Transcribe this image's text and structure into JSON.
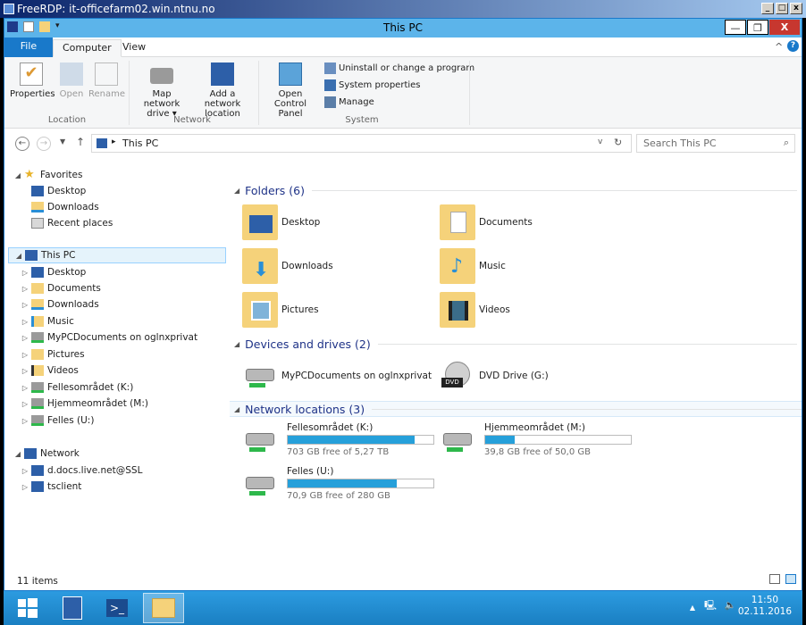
{
  "rdp": {
    "title": "FreeRDP: it-officefarm02.win.ntnu.no",
    "min": "_",
    "max": "□",
    "close": "x"
  },
  "window": {
    "title": "This PC",
    "min": "—",
    "max": "❐",
    "close": "X"
  },
  "ribbon": {
    "tabs": [
      "File",
      "Computer",
      "View"
    ],
    "location": {
      "group": "Location",
      "properties": "Properties",
      "open": "Open",
      "rename": "Rename"
    },
    "network": {
      "group": "Network",
      "map": "Map network drive ▾",
      "add": "Add a network location"
    },
    "system": {
      "group": "System",
      "open_cp": "Open Control Panel",
      "uninstall": "Uninstall or change a program",
      "sysprops": "System properties",
      "manage": "Manage"
    }
  },
  "address": {
    "path": "This PC",
    "search_placeholder": "Search This PC"
  },
  "nav": {
    "favorites": "Favorites",
    "fav_items": [
      "Desktop",
      "Downloads",
      "Recent places"
    ],
    "thispc": "This PC",
    "pc_items": [
      "Desktop",
      "Documents",
      "Downloads",
      "Music",
      "MyPCDocuments on oglnxprivat",
      "Pictures",
      "Videos",
      "Fellesområdet (K:)",
      "Hjemmeområdet (M:)",
      "Felles (U:)"
    ],
    "network": "Network",
    "net_items": [
      "d.docs.live.net@SSL",
      "tsclient"
    ]
  },
  "content": {
    "folders_hdr": "Folders (6)",
    "folders": [
      "Desktop",
      "Documents",
      "Downloads",
      "Music",
      "Pictures",
      "Videos"
    ],
    "devices_hdr": "Devices and drives (2)",
    "devices": [
      "MyPCDocuments on oglnxprivat",
      "DVD Drive (G:)"
    ],
    "netloc_hdr": "Network locations (3)",
    "netlocs": [
      {
        "name": "Fellesområdet (K:)",
        "free": "703 GB free of 5,27 TB",
        "used": 0.87
      },
      {
        "name": "Hjemmeområdet (M:)",
        "free": "39,8 GB free of 50,0 GB",
        "used": 0.2
      },
      {
        "name": "Felles (U:)",
        "free": "70,9 GB free of 280 GB",
        "used": 0.75
      }
    ]
  },
  "status": {
    "count": "11 items"
  },
  "tray": {
    "time": "11:50",
    "date": "02.11.2016"
  },
  "colors": {
    "accent": "#1979ca",
    "title": "#5cb4ea",
    "bar": "#26a0da"
  }
}
